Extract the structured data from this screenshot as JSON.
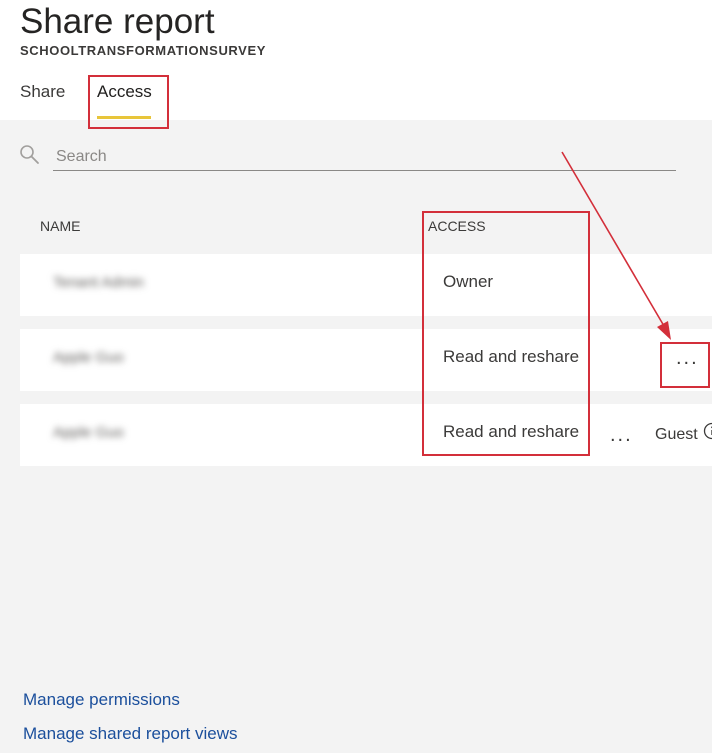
{
  "header": {
    "title": "Share report",
    "subtitle": "SCHOOLTRANSFORMATIONSURVEY"
  },
  "tabs": [
    {
      "label": "Share",
      "selected": false
    },
    {
      "label": "Access",
      "selected": true
    }
  ],
  "search": {
    "placeholder": "Search",
    "value": ""
  },
  "table": {
    "columns": [
      "NAME",
      "ACCESS"
    ],
    "rows": [
      {
        "name": "Tenant Admin",
        "access": "Owner",
        "more": "",
        "extra": ""
      },
      {
        "name": "Apple Guo",
        "access": "Read and reshare",
        "more": "...",
        "extra": ""
      },
      {
        "name": "Apple Guo",
        "access": "Read and reshare",
        "more": "...",
        "extra": "Guest"
      }
    ]
  },
  "links": {
    "manage_permissions": "Manage permissions",
    "manage_shared_views": "Manage shared report views"
  },
  "colors": {
    "accent_underline": "#e8c53a",
    "annotation_red": "#d32f3a",
    "link": "#1b4f9c"
  },
  "icons": {
    "search": "search-icon",
    "info": "info-icon"
  }
}
